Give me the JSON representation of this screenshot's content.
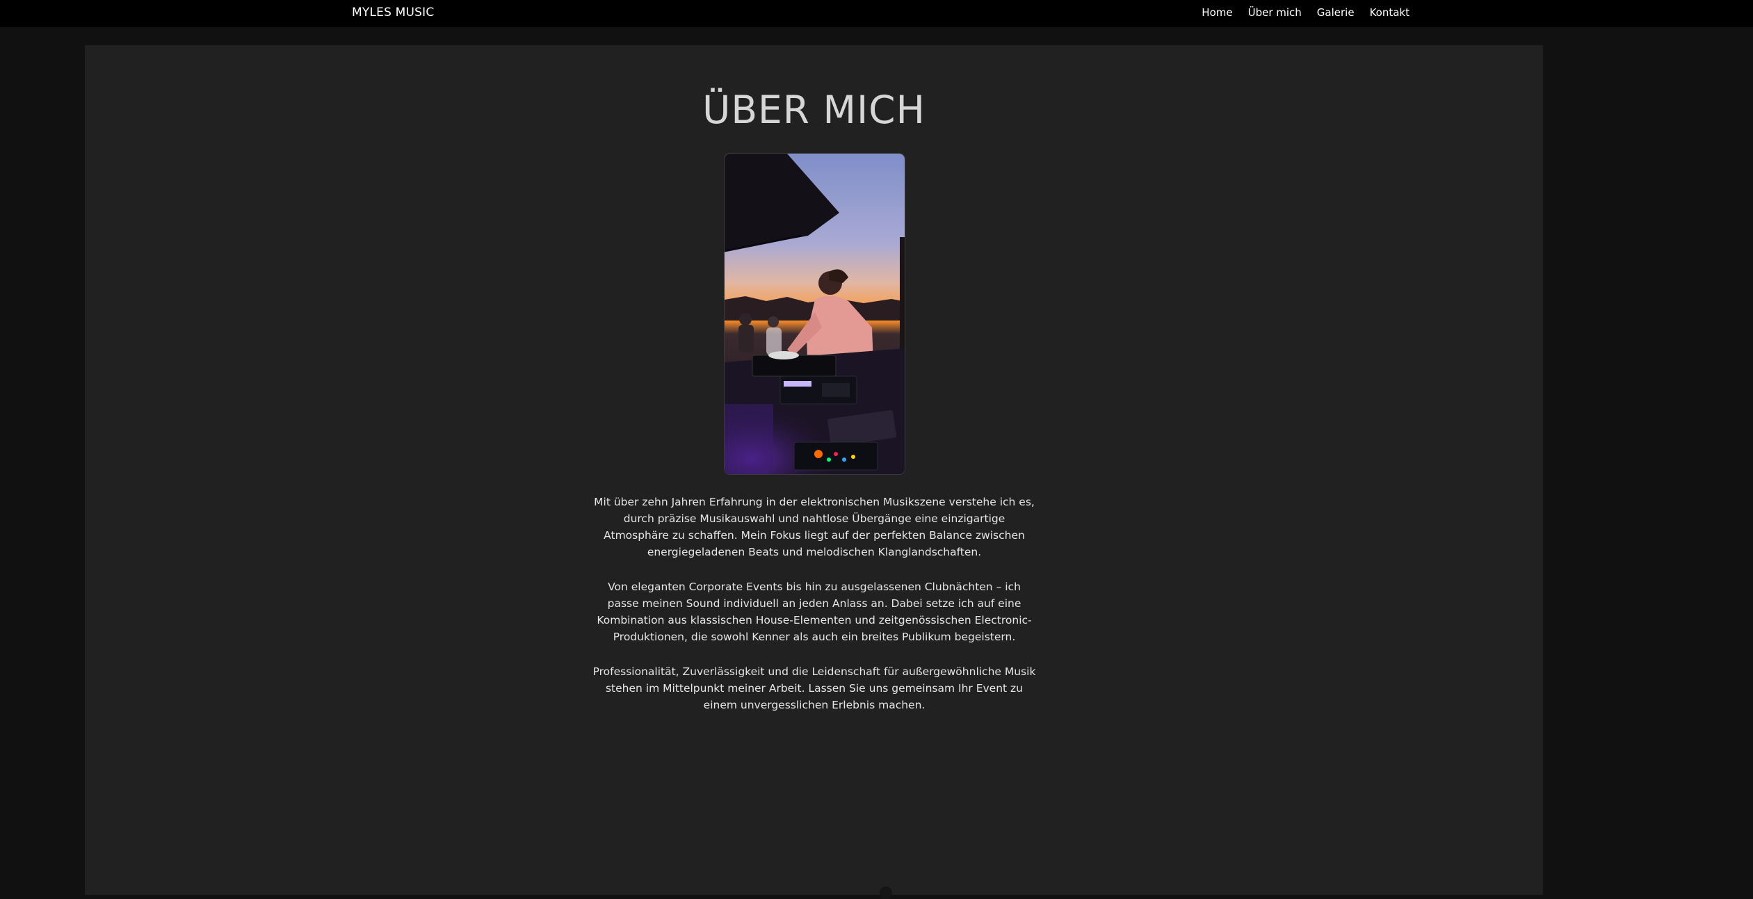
{
  "navbar": {
    "brand": "MYLES MUSIC",
    "links": [
      "Home",
      "Über mich",
      "Galerie",
      "Kontakt"
    ]
  },
  "page": {
    "title": "ÜBER MICH"
  },
  "photo": {
    "icon": "dj-sunset-photo"
  },
  "about": {
    "paragraphs": [
      "Mit über zehn Jahren Erfahrung in der elektronischen Musikszene verstehe ich es, durch präzise Musikauswahl und nahtlose Übergänge eine einzigartige Atmosphäre zu schaffen. Mein Fokus liegt auf der perfekten Balance zwischen energiegeladenen Beats und melodischen Klanglandschaften.",
      "Von eleganten Corporate Events bis hin zu ausgelassenen Clubnächten – ich passe meinen Sound individuell an jeden Anlass an. Dabei setze ich auf eine Kombination aus klassischen House-Elementen und zeitgenössischen Electronic-Produktionen, die sowohl Kenner als auch ein breites Publikum begeistern.",
      "Professionalität, Zuverlässigkeit und die Leidenschaft für außergewöhnliche Musik stehen im Mittelpunkt meiner Arbeit. Lassen Sie uns gemeinsam Ihr Event zu einem unvergesslichen Erlebnis machen."
    ]
  },
  "colors": {
    "navbar_bg": "#000000",
    "page_bg": "#111111",
    "panel_bg": "#212121",
    "title": "#d6d6d6",
    "text": "#e6e6e6"
  }
}
